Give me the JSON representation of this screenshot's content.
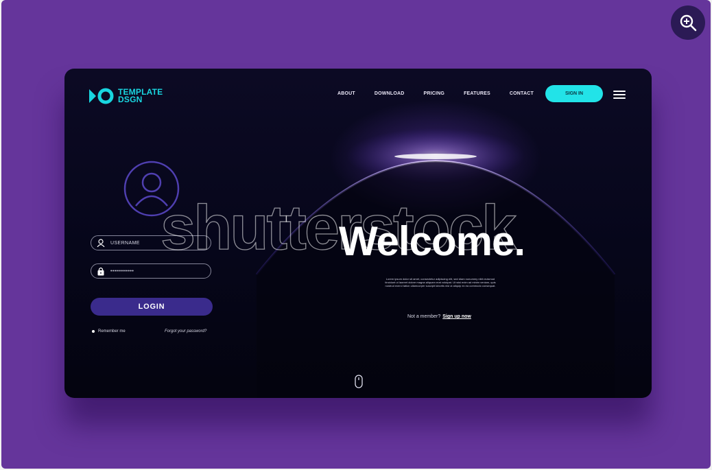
{
  "header": {
    "logo_line1": "TEMPLATE",
    "logo_line2": "DSGN",
    "nav": [
      "ABOUT",
      "DOWNLOAD",
      "PRICING",
      "FEATURES",
      "CONTACT"
    ],
    "signin_label": "SIGN IN",
    "menu_icon": "hamburger-icon"
  },
  "login": {
    "avatar_icon": "user-icon",
    "username_placeholder": "USERNAME",
    "password_value": "••••••••••••",
    "login_label": "LOGIN",
    "remember_label": "Remember me",
    "forgot_label": "Forgot your password?"
  },
  "hero": {
    "title": "Welcome.",
    "body": "Lorem ipsum dolor sit amet, consectetur adipiscing elit, sed diam nonummy nibh euismod tincidunt ut laoreet dolore magna aliquam erat volutpat. Ut wisi enim ad minim veniam, quis nostrud exerci tation ullamcorper suscipit lobortis nisl ut aliquip ex ea commodo consequat.",
    "member_text": "Not a member?",
    "signup_link": "Sign up now",
    "scroll_icon": "mouse-icon"
  },
  "watermark": "shutterstock",
  "zoom_icon": "zoom-in-icon",
  "colors": {
    "frame_bg": "#65359b",
    "accent_cyan": "#22e3e8",
    "login_button": "#3a2b8c",
    "glow": "#9a6bff"
  }
}
